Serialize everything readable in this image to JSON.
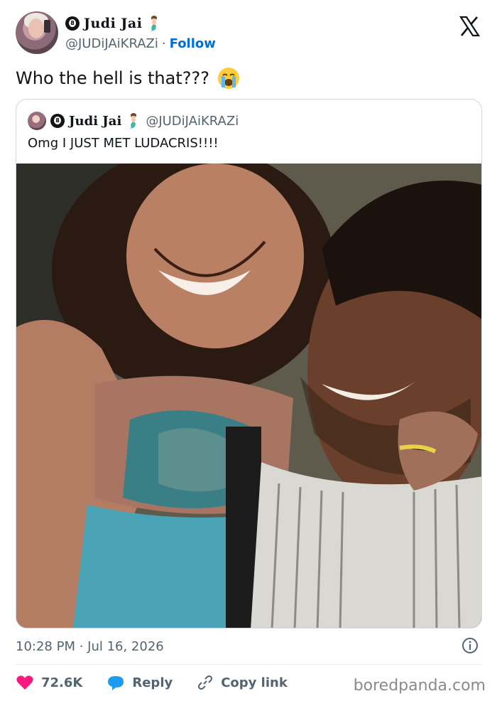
{
  "author": {
    "display_name": "Judi Jai",
    "handle": "@JUDiJAiKRAZi",
    "follow_label": "Follow"
  },
  "tweet": {
    "text": "Who the hell is that???"
  },
  "quoted": {
    "display_name": "Judi Jai",
    "handle": "@JUDiJAiKRAZi",
    "text": "Omg I JUST MET LUDACRIS!!!!"
  },
  "meta": {
    "timestamp": "10:28 PM · Jul 16, 2026"
  },
  "actions": {
    "like_count": "72.6K",
    "reply_label": "Reply",
    "copy_label": "Copy link"
  },
  "watermark": "boredpanda.com",
  "icons": [
    "eight-ball-icon",
    "mermaid-icon",
    "x-logo-icon",
    "crying-face-icon",
    "info-icon",
    "heart-icon",
    "reply-bubble-icon",
    "link-icon"
  ],
  "colors": {
    "link": "#006fd6",
    "secondary_text": "#536471",
    "like": "#f91880",
    "reply": "#1d9bf0",
    "border": "#cfd9de"
  }
}
